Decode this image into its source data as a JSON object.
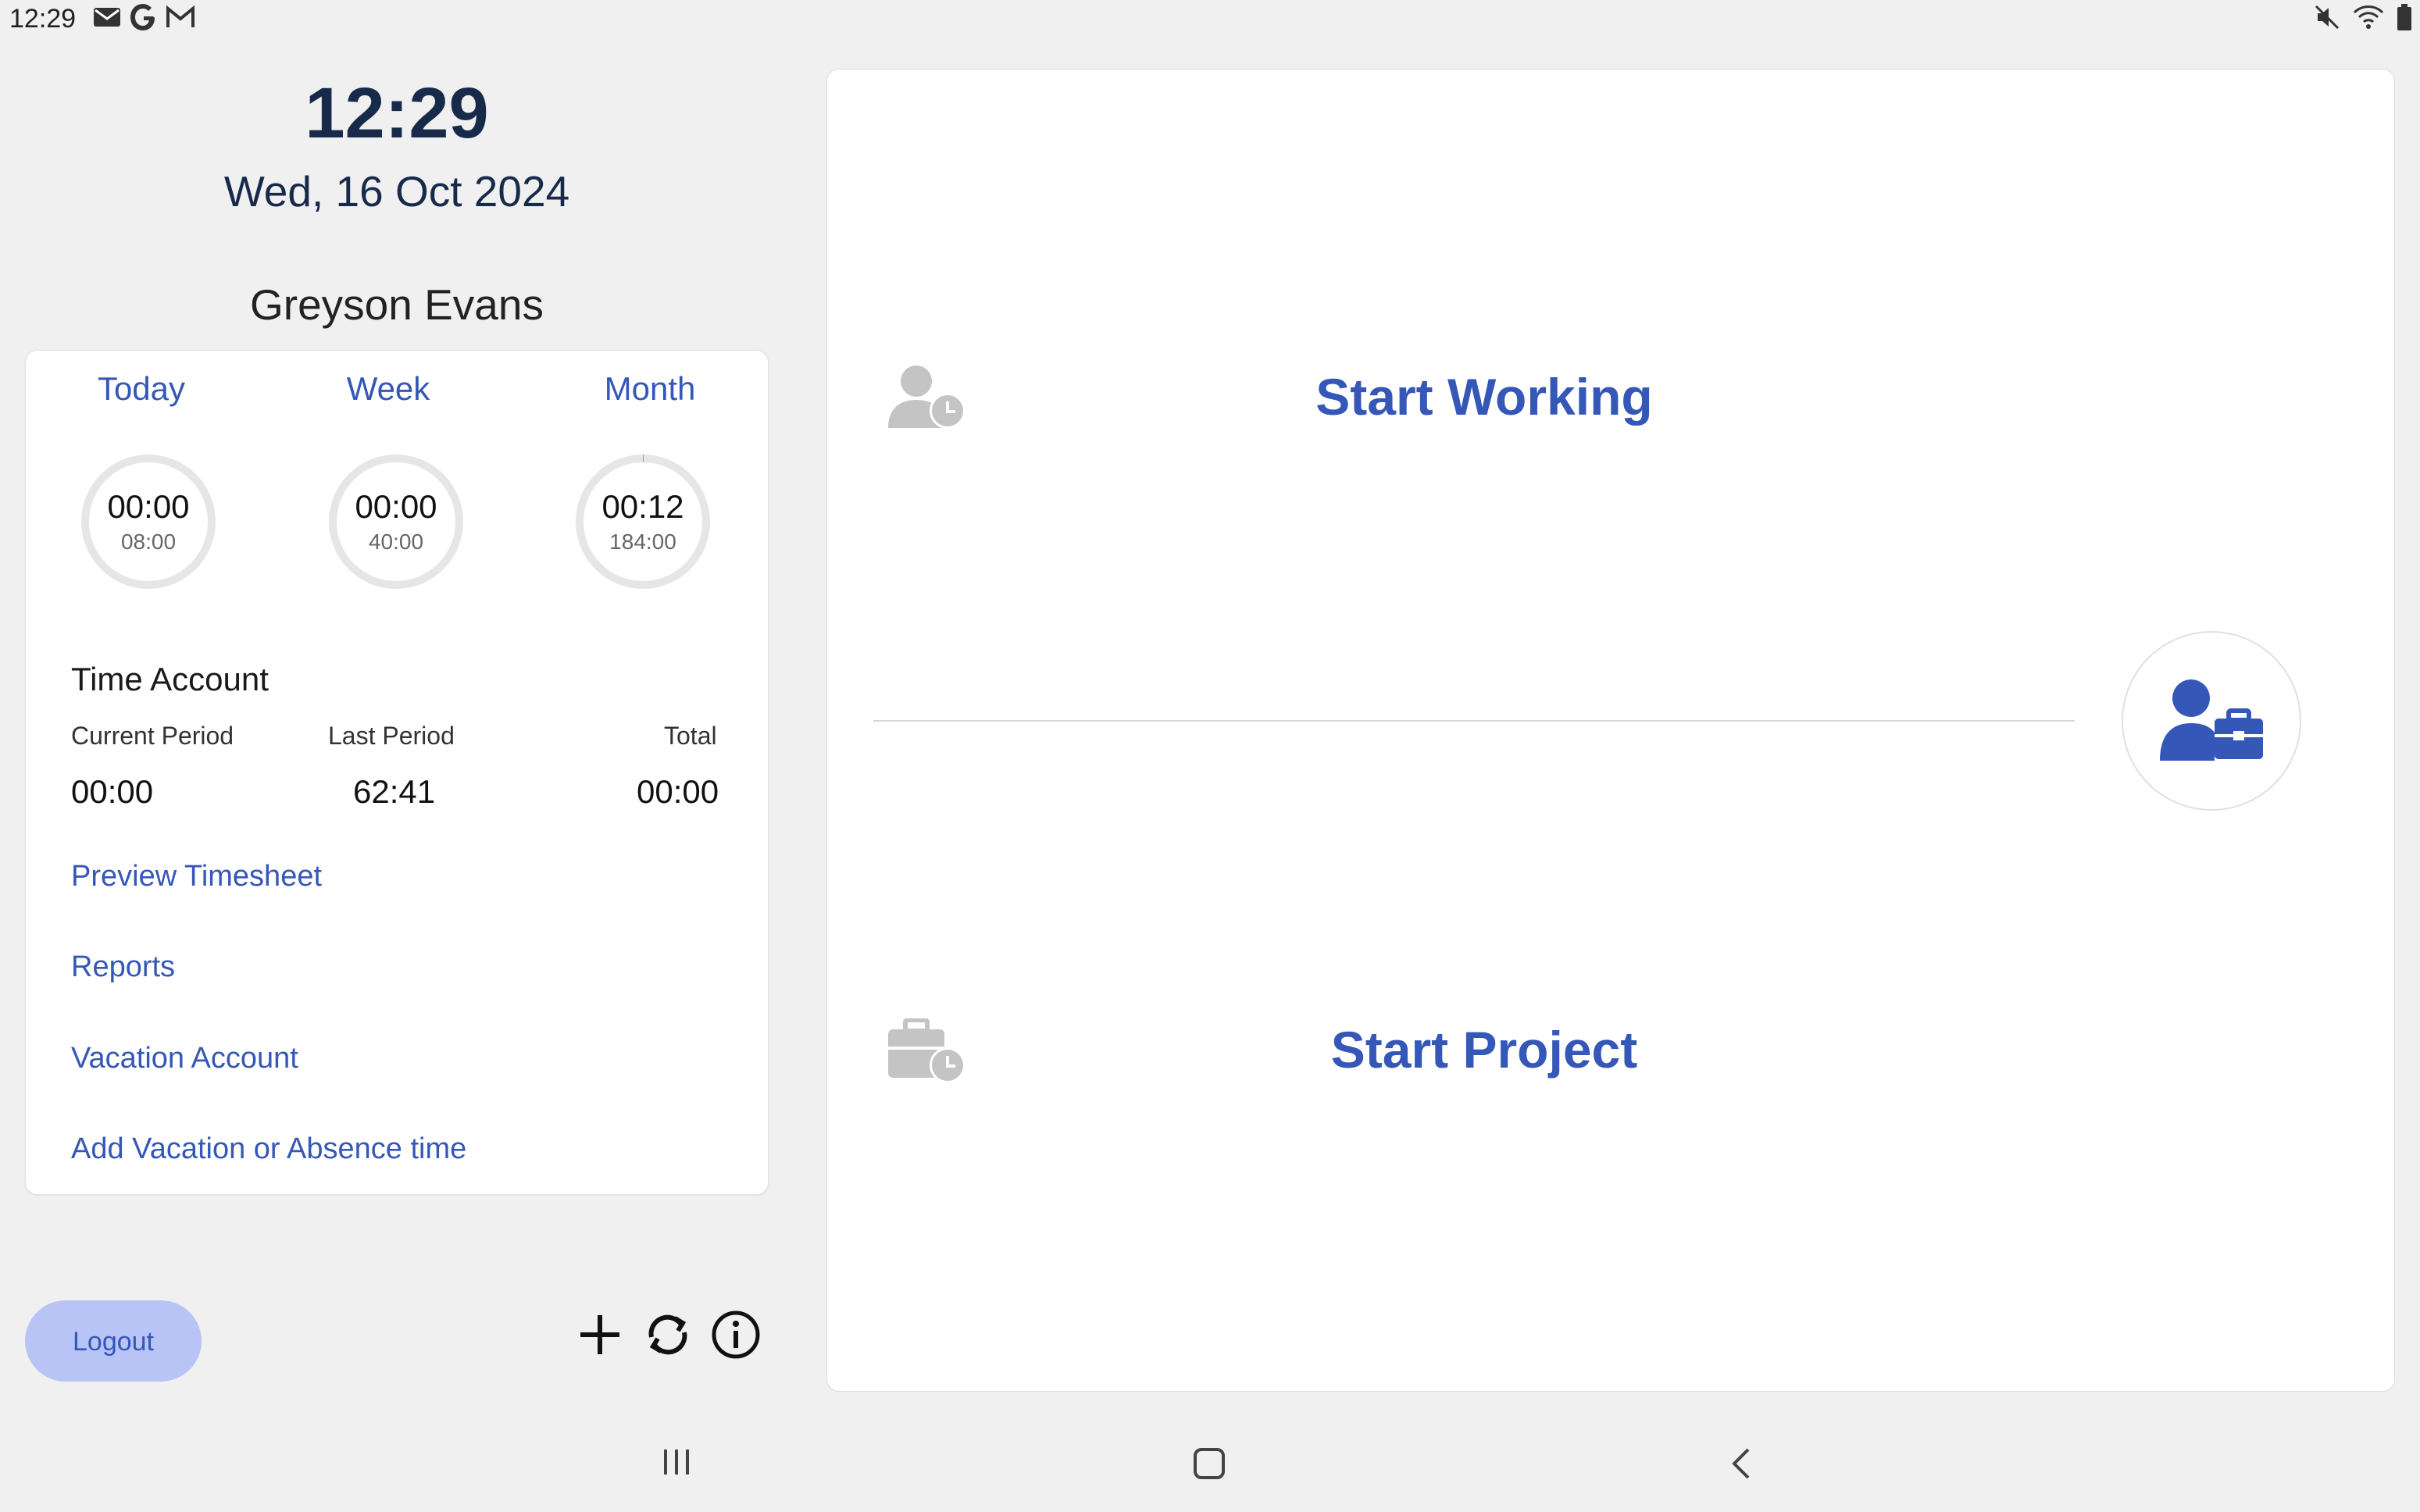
{
  "status_bar": {
    "time": "12:29",
    "left_icons": [
      "mail-icon",
      "google-icon",
      "gmail-icon"
    ],
    "right_icons": [
      "mute-icon",
      "wifi-icon",
      "battery-icon"
    ]
  },
  "header": {
    "clock": "12:29",
    "date": "Wed, 16 Oct 2024",
    "user_name": "Greyson Evans"
  },
  "periods": [
    {
      "label": "Today",
      "value": "00:00",
      "target": "08:00",
      "progress": 0.0
    },
    {
      "label": "Week",
      "value": "00:00",
      "target": "40:00",
      "progress": 0.0
    },
    {
      "label": "Month",
      "value": "00:12",
      "target": "184:00",
      "progress": 0.001
    }
  ],
  "time_account": {
    "title": "Time Account",
    "columns": [
      {
        "head": "Current Period",
        "value": "00:00"
      },
      {
        "head": "Last Period",
        "value": "62:41"
      },
      {
        "head": "Total",
        "value": "00:00"
      }
    ]
  },
  "links": {
    "preview_timesheet": "Preview Timesheet",
    "reports": "Reports",
    "vacation_account": "Vacation Account",
    "add_absence": "Add Vacation or Absence time"
  },
  "footer": {
    "logout": "Logout",
    "tools": [
      "add-icon",
      "sync-icon",
      "info-icon"
    ]
  },
  "actions": {
    "start_working": "Start Working",
    "start_project": "Start Project"
  },
  "colors": {
    "accent": "#3557b8",
    "logout_bg": "#b7c4f5",
    "dark_text": "#172a4a",
    "icon_grey": "#c4c4c4"
  }
}
